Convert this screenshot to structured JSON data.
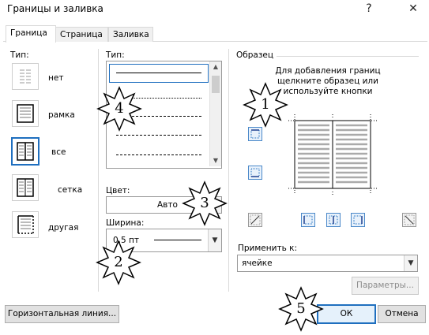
{
  "window": {
    "title": "Границы и заливка",
    "help": "?",
    "close": "✕"
  },
  "tabs": [
    {
      "label": "Граница"
    },
    {
      "label": "Страница"
    },
    {
      "label": "Заливка"
    }
  ],
  "type_section": {
    "label": "Тип:",
    "items": [
      {
        "label": "нет"
      },
      {
        "label": "рамка"
      },
      {
        "label": "все"
      },
      {
        "label": "сетка"
      },
      {
        "label": "другая"
      }
    ]
  },
  "style_section": {
    "label": "Тип:"
  },
  "color": {
    "label": "Цвет:",
    "value": "Авто"
  },
  "width": {
    "label": "Ширина:",
    "value": "0,5 пт"
  },
  "preview": {
    "label": "Образец",
    "hint_line1": "Для добавления границ",
    "hint_line2": "щелкните образец или",
    "hint_line3": "используйте кнопки"
  },
  "apply_to": {
    "label": "Применить к:",
    "value": "ячейке"
  },
  "buttons": {
    "parameters": "Параметры...",
    "horizontal_line": "Горизонтальная линия...",
    "ok": "ОК",
    "cancel": "Отмена"
  },
  "annotations": [
    "1",
    "2",
    "3",
    "4",
    "5"
  ]
}
